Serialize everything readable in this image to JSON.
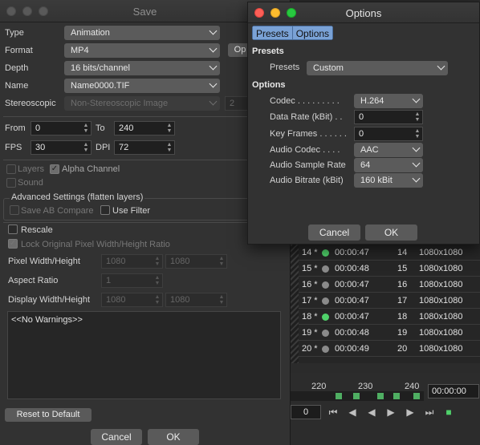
{
  "save": {
    "title": "Save",
    "type_label": "Type",
    "type_value": "Animation",
    "format_label": "Format",
    "format_value": "MP4",
    "options_button": "Op",
    "depth_label": "Depth",
    "depth_value": "16 bits/channel",
    "name_label": "Name",
    "name_value": "Name0000.TIF",
    "stereo_label": "Stereoscopic",
    "stereo_value": "Non-Stereoscopic Image",
    "stereo_num": "2",
    "from_label": "From",
    "from_value": "0",
    "to_label": "To",
    "to_value": "240",
    "fps_label": "FPS",
    "fps_value": "30",
    "dpi_label": "DPI",
    "dpi_value": "72",
    "layers_label": "Layers",
    "alpha_label": "Alpha Channel",
    "sound_label": "Sound",
    "advanced_title": "Advanced Settings (flatten layers)",
    "save_ab_label": "Save AB Compare",
    "use_filter_label": "Use Filter",
    "rescale_label": "Rescale",
    "lock_label": "Lock Original Pixel Width/Height Ratio",
    "pw_label": "Pixel Width/Height",
    "pw_w": "1080",
    "pw_h": "1080",
    "aspect_label": "Aspect Ratio",
    "aspect_value": "1",
    "dw_label": "Display Width/Height",
    "dw_w": "1080",
    "dw_h": "1080",
    "warnings": "<<No Warnings>>",
    "reset_button": "Reset to Default",
    "cancel_button": "Cancel",
    "ok_button": "OK"
  },
  "options": {
    "title": "Options",
    "tabs": [
      "Presets",
      "Options"
    ],
    "presets_header": "Presets",
    "presets_label": "Presets",
    "presets_value": "Custom",
    "options_header": "Options",
    "codec_label": "Codec",
    "codec_dots": ". . . . . . . . .",
    "codec_value": "H.264",
    "datarate_label": "Data Rate (kBit)",
    "datarate_dots": ". .",
    "datarate_value": "0",
    "keyframes_label": "Key Frames",
    "keyframes_dots": ". . . . . .",
    "keyframes_value": "0",
    "audiocodec_label": "Audio Codec",
    "audiocodec_dots": ". . . .",
    "audiocodec_value": "AAC",
    "samplerate_label": "Audio Sample Rate",
    "samplerate_value": "64",
    "bitrate_label": "Audio Bitrate (kBit)",
    "bitrate_value": "160 kBit",
    "cancel_button": "Cancel",
    "ok_button": "OK"
  },
  "frames": [
    {
      "num": "14 *",
      "status": "green",
      "time": "00:00:47",
      "frame": "14",
      "res": "1080x1080"
    },
    {
      "num": "15 *",
      "status": "gray",
      "time": "00:00:48",
      "frame": "15",
      "res": "1080x1080"
    },
    {
      "num": "16 *",
      "status": "gray",
      "time": "00:00:47",
      "frame": "16",
      "res": "1080x1080"
    },
    {
      "num": "17 *",
      "status": "gray",
      "time": "00:00:47",
      "frame": "17",
      "res": "1080x1080"
    },
    {
      "num": "18 *",
      "status": "green",
      "time": "00:00:47",
      "frame": "18",
      "res": "1080x1080"
    },
    {
      "num": "19 *",
      "status": "gray",
      "time": "00:00:48",
      "frame": "19",
      "res": "1080x1080"
    },
    {
      "num": "20 *",
      "status": "gray",
      "time": "00:00:49",
      "frame": "20",
      "res": "1080x1080"
    }
  ],
  "timeline": {
    "ticks": [
      "220",
      "230",
      "240"
    ],
    "timecode": "00:00:00",
    "frame_field": "0"
  },
  "colors": {
    "status_green": "#4fd16a",
    "status_gray": "#8a8a8a",
    "tab_blue": "#7aa2d6"
  }
}
